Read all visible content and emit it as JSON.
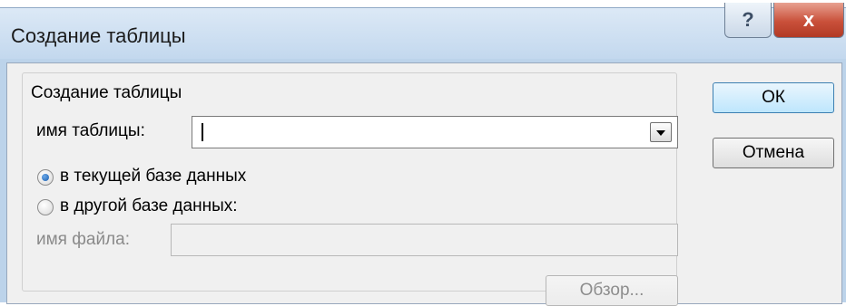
{
  "dialog": {
    "title": "Создание таблицы",
    "help_label": "?",
    "close_label": "x"
  },
  "group": {
    "legend": "Создание таблицы",
    "table_name_label": "имя таблицы:",
    "table_name_value": ""
  },
  "options": {
    "current_db": "в текущей базе данных",
    "other_db": "в другой базе данных:",
    "selected": "current_db"
  },
  "file": {
    "label": "имя файла:",
    "value": ""
  },
  "buttons": {
    "ok": "ОК",
    "cancel": "Отмена",
    "browse": "Обзор..."
  }
}
